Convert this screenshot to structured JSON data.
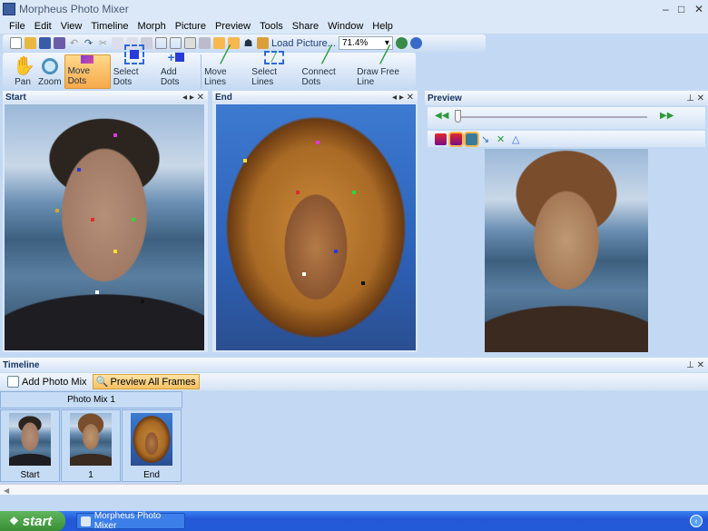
{
  "app": {
    "title": "Morpheus Photo Mixer"
  },
  "menu": [
    "File",
    "Edit",
    "View",
    "Timeline",
    "Morph",
    "Picture",
    "Preview",
    "Tools",
    "Share",
    "Window",
    "Help"
  ],
  "toolbar": {
    "load_picture": "Load Picture...",
    "zoom": "71.4%"
  },
  "tools": [
    {
      "label": "Pan",
      "icon": "hand-icon"
    },
    {
      "label": "Zoom",
      "icon": "magnifier-icon"
    },
    {
      "label": "Move Dots",
      "icon": "move-dots-icon",
      "active": true
    },
    {
      "label": "Select Dots",
      "icon": "select-dots-icon"
    },
    {
      "label": "Add Dots",
      "icon": "add-dots-icon"
    },
    {
      "label": "Move Lines",
      "icon": "move-lines-icon"
    },
    {
      "label": "Select Lines",
      "icon": "select-lines-icon"
    },
    {
      "label": "Connect Dots",
      "icon": "connect-dots-icon"
    },
    {
      "label": "Draw Free Line",
      "icon": "draw-line-icon"
    }
  ],
  "panels": {
    "start": "Start",
    "end": "End",
    "preview": "Preview"
  },
  "timeline": {
    "title": "Timeline",
    "add_label": "Add Photo Mix",
    "preview_label": "Preview All Frames",
    "mix_title": "Photo Mix 1",
    "frames": [
      "Start",
      "1",
      "End"
    ]
  },
  "taskbar": {
    "start": "start",
    "item": "Morpheus Photo Mixer"
  },
  "colors": {
    "accent": "#f7a84a",
    "bg": "#c3d9f3",
    "taskbar": "#2458d6"
  }
}
